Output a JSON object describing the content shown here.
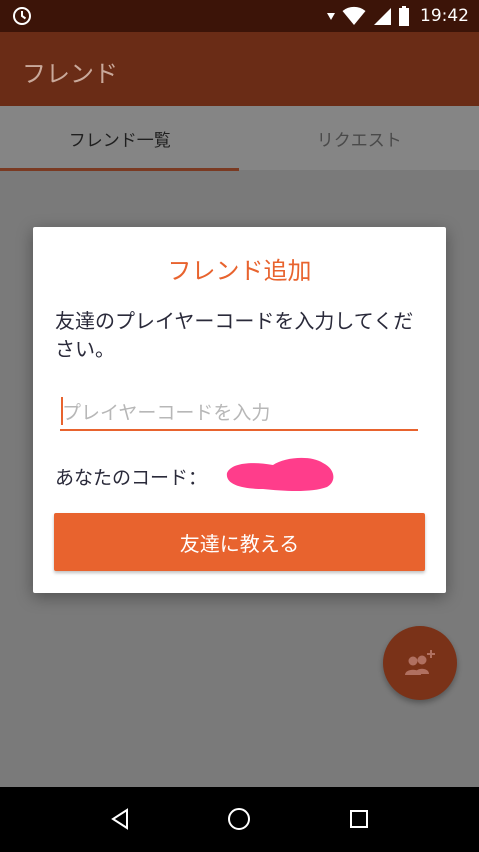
{
  "status_bar": {
    "time": "19:42"
  },
  "app_bar": {
    "title": "フレンド"
  },
  "tabs": [
    {
      "label": "フレンド一覧",
      "active": true
    },
    {
      "label": "リクエスト",
      "active": false
    }
  ],
  "dialog": {
    "title": "フレンド追加",
    "message": "友達のプレイヤーコードを入力してください。",
    "input_placeholder": "プレイヤーコードを入力",
    "input_value": "",
    "your_code_label": "あなたのコード：",
    "share_button_label": "友達に教える"
  },
  "colors": {
    "accent": "#e8632e",
    "app_bar_dimmed": "#6a2c16",
    "redaction": "#ff3d8b"
  },
  "icons": {
    "status_left": "clock-icon",
    "status_right": [
      "vibrate-icon",
      "wifi-icon",
      "signal-icon",
      "battery-icon"
    ],
    "fab": "add-friend-icon",
    "nav": [
      "back-icon",
      "home-icon",
      "recents-icon"
    ]
  }
}
